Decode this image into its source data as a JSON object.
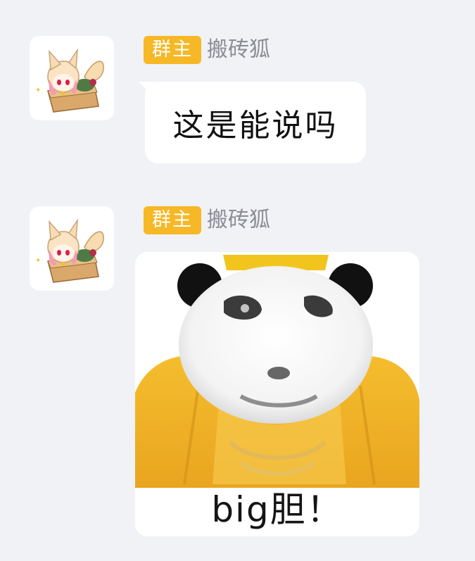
{
  "messages": [
    {
      "avatar_icon": "fox-girl-in-box-avatar",
      "role_badge": "群主",
      "sender": "搬砖狐",
      "type": "text",
      "text": "这是能说吗"
    },
    {
      "avatar_icon": "fox-girl-in-box-avatar",
      "role_badge": "群主",
      "sender": "搬砖狐",
      "type": "image",
      "image_icon": "panda-emperor-meme-image",
      "caption": "big胆！"
    }
  ],
  "colors": {
    "background": "#f1f2f6",
    "badge": "#f6b826",
    "bubble": "#ffffff",
    "sender_name": "#8a8d94",
    "robe": "#f0b22a"
  }
}
